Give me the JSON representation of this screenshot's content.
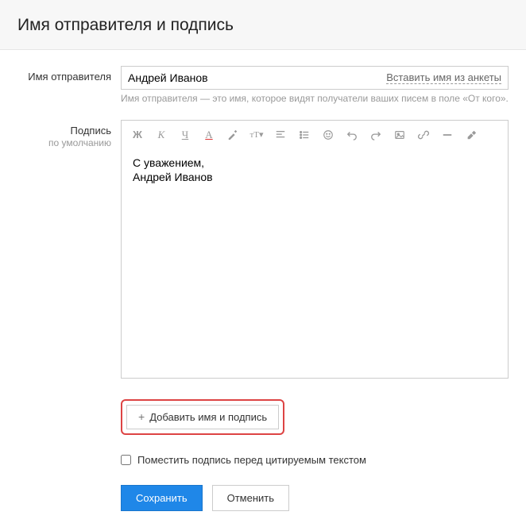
{
  "header": {
    "title": "Имя отправителя и подпись"
  },
  "senderName": {
    "label": "Имя отправителя",
    "value": "Андрей Иванов",
    "insertLink": "Вставить имя из анкеты",
    "hint": "Имя отправителя — это имя, которое видят получатели ваших писем в поле «От кого»."
  },
  "signature": {
    "label": "Подпись",
    "sublabel": "по умолчанию",
    "content": "С уважением,\nАндрей Иванов"
  },
  "toolbar": {
    "icons": [
      "bold",
      "italic",
      "underline",
      "text-color",
      "bg-color",
      "font-size",
      "align",
      "list",
      "emoji",
      "undo",
      "redo",
      "image",
      "link",
      "hr",
      "clear"
    ]
  },
  "addButton": {
    "label": "Добавить имя и подпись"
  },
  "checkbox": {
    "label": "Поместить подпись перед цитируемым текстом",
    "checked": false
  },
  "actions": {
    "save": "Сохранить",
    "cancel": "Отменить"
  }
}
